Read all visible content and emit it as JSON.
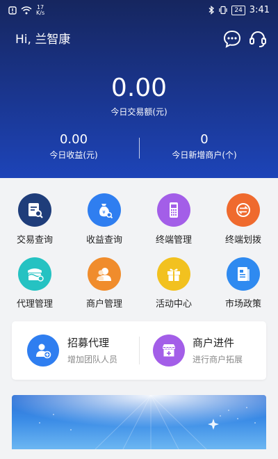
{
  "status_bar": {
    "speed_value": "17",
    "speed_unit": "K/s",
    "battery": "24",
    "time": "3:41"
  },
  "header": {
    "greeting": "Hi, 兰智康",
    "amount": "0.00",
    "amount_label": "今日交易额(元)",
    "stats": [
      {
        "value": "0.00",
        "label": "今日收益(元)"
      },
      {
        "value": "0",
        "label": "今日新增商户(个)"
      }
    ]
  },
  "grid": [
    {
      "label": "交易查询",
      "icon": "transaction-search-icon",
      "color": "#1f3d7a"
    },
    {
      "label": "收益查询",
      "icon": "earnings-search-icon",
      "color": "#2f7ef0"
    },
    {
      "label": "终端管理",
      "icon": "terminal-icon",
      "color": "#a35ee8"
    },
    {
      "label": "终端划拨",
      "icon": "transfer-icon",
      "color": "#ef6a2e"
    },
    {
      "label": "代理管理",
      "icon": "agent-icon",
      "color": "#25c2c2"
    },
    {
      "label": "商户管理",
      "icon": "merchant-user-icon",
      "color": "#f08c2c"
    },
    {
      "label": "活动中心",
      "icon": "gift-icon",
      "color": "#f2c11f"
    },
    {
      "label": "市场政策",
      "icon": "policy-doc-icon",
      "color": "#2f8af0"
    }
  ],
  "card": {
    "left": {
      "title": "招募代理",
      "subtitle": "增加团队人员",
      "color": "#2f7ef0"
    },
    "right": {
      "title": "商户进件",
      "subtitle": "进行商户拓展",
      "color": "#a35ee8"
    }
  }
}
